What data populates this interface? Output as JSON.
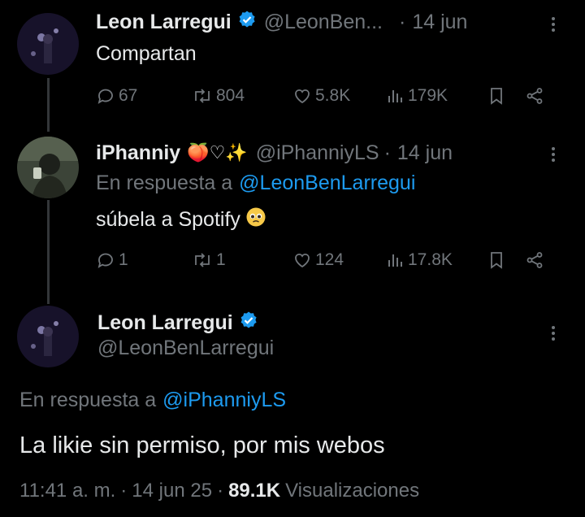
{
  "tweet1": {
    "name": "Leon Larregui",
    "handle": "@LeonBen...",
    "dot": "·",
    "date": "14 jun",
    "text": "Compartan",
    "replies": "67",
    "retweets": "804",
    "likes": "5.8K",
    "views": "179K"
  },
  "tweet2": {
    "name": "iPhanniy",
    "emoji": "🍑♡✨",
    "handle": "@iPhanniyLS",
    "dot": "·",
    "date": "14 jun",
    "reply_prefix": "En respuesta a",
    "reply_to": "@LeonBenLarregui",
    "text": "súbela a Spotify",
    "text_emoji": "🥺",
    "replies": "1",
    "retweets": "1",
    "likes": "124",
    "views": "17.8K"
  },
  "tweet3": {
    "name": "Leon Larregui",
    "handle": "@LeonBenLarregui",
    "reply_prefix": "En respuesta a",
    "reply_to": "@iPhanniyLS",
    "text": "La likie sin permiso, por mis webos",
    "time": "11:41 a. m.",
    "dot1": "·",
    "date": "14 jun 25",
    "dot2": "·",
    "views_count": "89.1K",
    "views_label": "Visualizaciones"
  },
  "colors": {
    "background": "#000000",
    "text": "#e7e9ea",
    "muted": "#71767b",
    "link": "#1d9bf0",
    "verified": "#1d9bf0"
  },
  "icons": [
    "reply-icon",
    "retweet-icon",
    "like-icon",
    "views-icon",
    "bookmark-icon",
    "share-icon",
    "verified-icon",
    "more-icon"
  ]
}
